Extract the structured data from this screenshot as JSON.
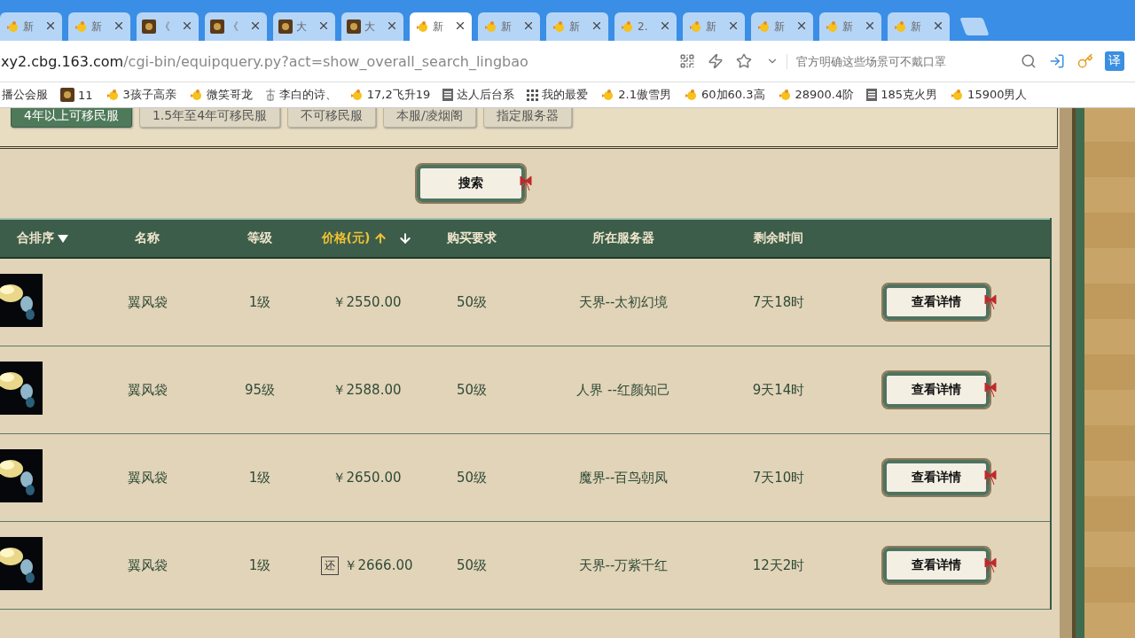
{
  "browser": {
    "tabs": [
      {
        "label": "新",
        "kind": "chick",
        "selected": false
      },
      {
        "label": "新",
        "kind": "chick",
        "selected": false
      },
      {
        "label": "《",
        "kind": "game",
        "selected": false
      },
      {
        "label": "《",
        "kind": "game",
        "selected": false
      },
      {
        "label": "大",
        "kind": "game",
        "selected": false
      },
      {
        "label": "大",
        "kind": "game",
        "selected": false
      },
      {
        "label": "新",
        "kind": "chick",
        "selected": true
      },
      {
        "label": "新",
        "kind": "chick",
        "selected": false
      },
      {
        "label": "新",
        "kind": "chick",
        "selected": false
      },
      {
        "label": "2.",
        "kind": "chick",
        "selected": false
      },
      {
        "label": "新",
        "kind": "chick",
        "selected": false
      },
      {
        "label": "新",
        "kind": "chick",
        "selected": false
      },
      {
        "label": "新",
        "kind": "chick",
        "selected": false
      },
      {
        "label": "新",
        "kind": "chick",
        "selected": false
      }
    ],
    "url_host": "xy2.cbg.163.com",
    "url_path": "/cgi-bin/equipquery.py?act=show_overall_search_lingbao",
    "search": {
      "placeholder": "官方明确这些场景可不戴口罩"
    },
    "translate_label": "译",
    "bookmarks": [
      {
        "label": "播公会服"
      },
      {
        "label": "11",
        "kind": "game"
      },
      {
        "label": "3孩子高亲",
        "kind": "chick"
      },
      {
        "label": "微笑哥龙",
        "kind": "chick"
      },
      {
        "label": "李白的诗、",
        "kind": "ancient"
      },
      {
        "label": "17,2飞升19",
        "kind": "chick"
      },
      {
        "label": "达人后台系",
        "kind": "doc"
      },
      {
        "label": "我的最爱",
        "kind": "apps"
      },
      {
        "label": "2.1傲雪男",
        "kind": "chick"
      },
      {
        "label": "60加60.3高",
        "kind": "chick"
      },
      {
        "label": "28900.4阶",
        "kind": "chick"
      },
      {
        "label": "185克火男",
        "kind": "doc"
      },
      {
        "label": "15900男人",
        "kind": "chick"
      }
    ]
  },
  "filters": [
    {
      "label": "4年以上可移民服",
      "selected": true
    },
    {
      "label": "1.5年至4年可移民服",
      "selected": false
    },
    {
      "label": "不可移民服",
      "selected": false
    },
    {
      "label": "本服/凌烟阁",
      "selected": false
    },
    {
      "label": "指定服务器",
      "selected": false
    }
  ],
  "search_button": "搜索",
  "table": {
    "columns": [
      "合排序",
      "名称",
      "等级",
      "价格(元)",
      "购买要求",
      "所在服务器",
      "剩余时间"
    ],
    "rows": [
      {
        "name": "翼风袋",
        "level": "1级",
        "price": "￥2550.00",
        "requirement": "50级",
        "server": "天界--太初幻境",
        "time_left": "7天18时",
        "action": "查看详情"
      },
      {
        "name": "翼风袋",
        "level": "95级",
        "price": "￥2588.00",
        "requirement": "50级",
        "server": "人界 --红颜知己",
        "time_left": "9天14时",
        "action": "查看详情"
      },
      {
        "name": "翼风袋",
        "level": "1级",
        "price": "￥2650.00",
        "requirement": "50级",
        "server": "魔界--百鸟朝凤",
        "time_left": "7天10时",
        "action": "查看详情"
      },
      {
        "name": "翼风袋",
        "level": "1级",
        "price": "￥2666.00",
        "tag": "还",
        "requirement": "50级",
        "server": "天界--万紫千红",
        "time_left": "12天2时",
        "action": "查看详情"
      }
    ]
  }
}
